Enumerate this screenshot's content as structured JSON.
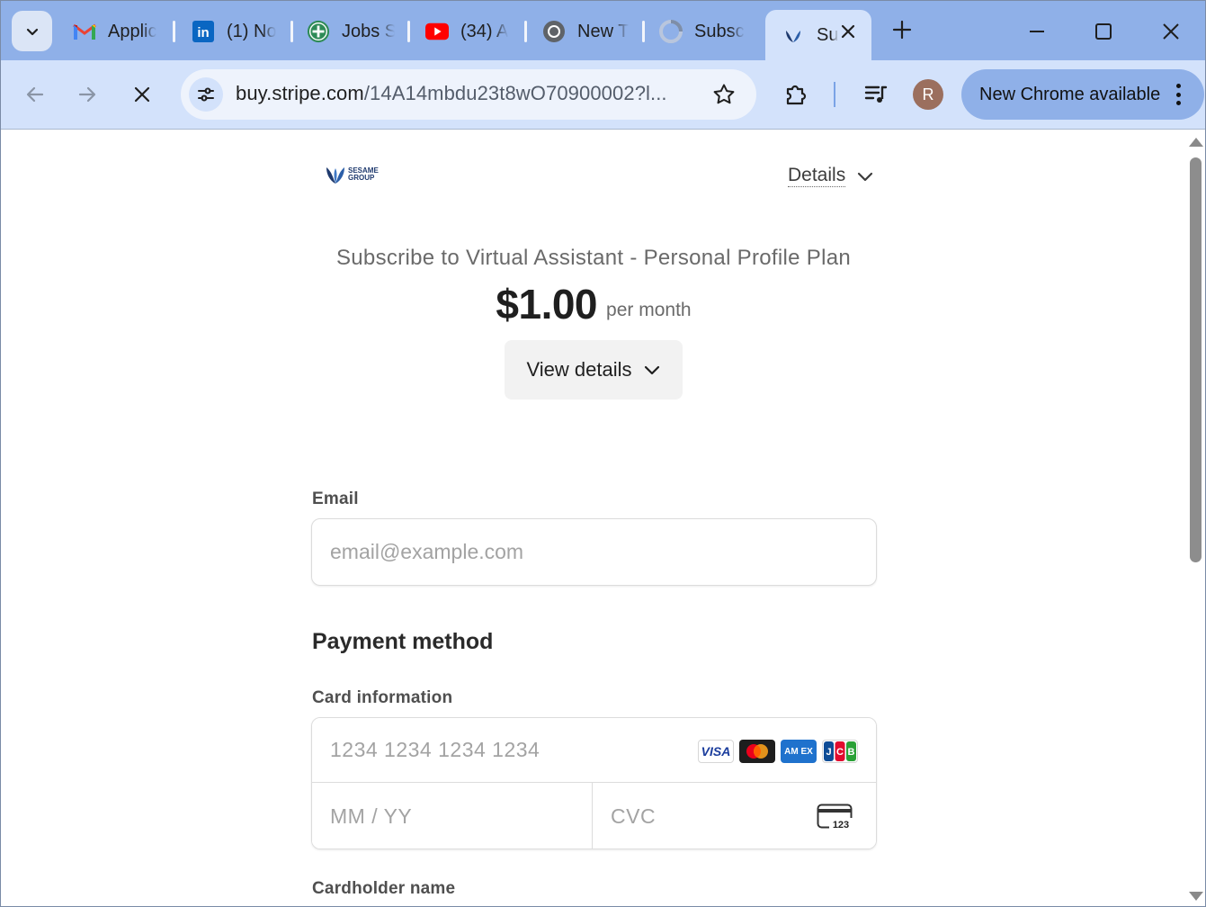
{
  "browser": {
    "tabs": [
      {
        "title": "Applic",
        "icon": "gmail-icon"
      },
      {
        "title": "(1) No",
        "icon": "linkedin-icon"
      },
      {
        "title": "Jobs S",
        "icon": "jobs-icon"
      },
      {
        "title": "(34) A",
        "icon": "youtube-icon"
      },
      {
        "title": "New T",
        "icon": "chrome-icon"
      },
      {
        "title": "Subsc",
        "icon": "loading-icon"
      },
      {
        "title": "Su",
        "icon": "sesame-icon",
        "active": true
      }
    ],
    "url_host": "buy.stripe.com",
    "url_path": "/14A14mbdu23t8wO70900002?l...",
    "profile_initial": "R",
    "update_label": "New Chrome available"
  },
  "page": {
    "logo_text_line1": "SESAME",
    "logo_text_line2": "GROUP",
    "details_label": "Details",
    "product_title": "Subscribe to Virtual Assistant - Personal Profile Plan",
    "price": "$1.00",
    "interval": "per month",
    "view_details_label": "View details",
    "email_label": "Email",
    "email_placeholder": "email@example.com",
    "payment_method_title": "Payment method",
    "card_info_label": "Card information",
    "card_number_placeholder": "1234 1234 1234 1234",
    "expiry_placeholder": "MM / YY",
    "cvc_placeholder": "CVC",
    "cvc_icon_text": "123",
    "card_brands": {
      "visa": "VISA",
      "amex": "AM EX"
    },
    "cardholder_label": "Cardholder name"
  },
  "colors": {
    "tabstrip": "#8fb0e8",
    "toolbar": "#d3e2fb",
    "brand_navy": "#1f3a6e"
  }
}
